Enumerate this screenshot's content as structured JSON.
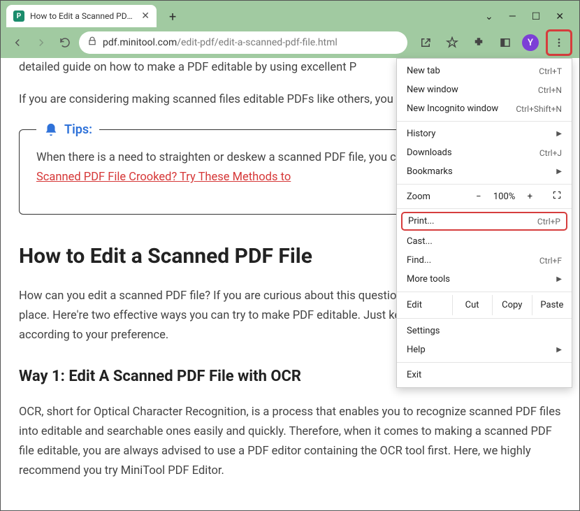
{
  "window": {
    "tab_title": "How to Edit a Scanned PDF File?",
    "url_host": "pdf.minitool.com",
    "url_path": "/edit-pdf/edit-a-scanned-pdf-file.html",
    "avatar_initial": "Y"
  },
  "page": {
    "p1": "detailed guide on how to make a PDF editable by using excellent P",
    "p2": "If you are considering making scanned files editable PDFs like others, you can follow the guide below.",
    "tips_label": "Tips:",
    "tips_text_pre": "When there is a need to straighten or deskew a scanned PDF file, you can refer to this post: ",
    "tips_link": "Is the Scanned PDF File Crooked? Try These Methods to",
    "h1": "How to Edit a Scanned PDF File",
    "p3": "How can you edit a scanned PDF file? If you are curious about this question, then you are at the right place. Here're two effective ways you can try to make PDF editable. Just keep reading and pick one according to your preference.",
    "h2": "Way 1: Edit A Scanned PDF File with OCR",
    "p4": "OCR, short for Optical Character Recognition, is a process that enables you to recognize scanned PDF files into editable and searchable ones easily and quickly. Therefore, when it comes to making a scanned PDF file editable, you are always advised to use a PDF editor containing the OCR tool first. Here, we highly recommend you try MiniTool PDF Editor."
  },
  "menu": {
    "new_tab": "New tab",
    "new_tab_sc": "Ctrl+T",
    "new_window": "New window",
    "new_window_sc": "Ctrl+N",
    "incognito": "New Incognito window",
    "incognito_sc": "Ctrl+Shift+N",
    "history": "History",
    "downloads": "Downloads",
    "downloads_sc": "Ctrl+J",
    "bookmarks": "Bookmarks",
    "zoom": "Zoom",
    "zoom_pct": "100%",
    "print": "Print...",
    "print_sc": "Ctrl+P",
    "cast": "Cast...",
    "find": "Find...",
    "find_sc": "Ctrl+F",
    "more_tools": "More tools",
    "edit": "Edit",
    "cut": "Cut",
    "copy": "Copy",
    "paste": "Paste",
    "settings": "Settings",
    "help": "Help",
    "exit": "Exit"
  }
}
